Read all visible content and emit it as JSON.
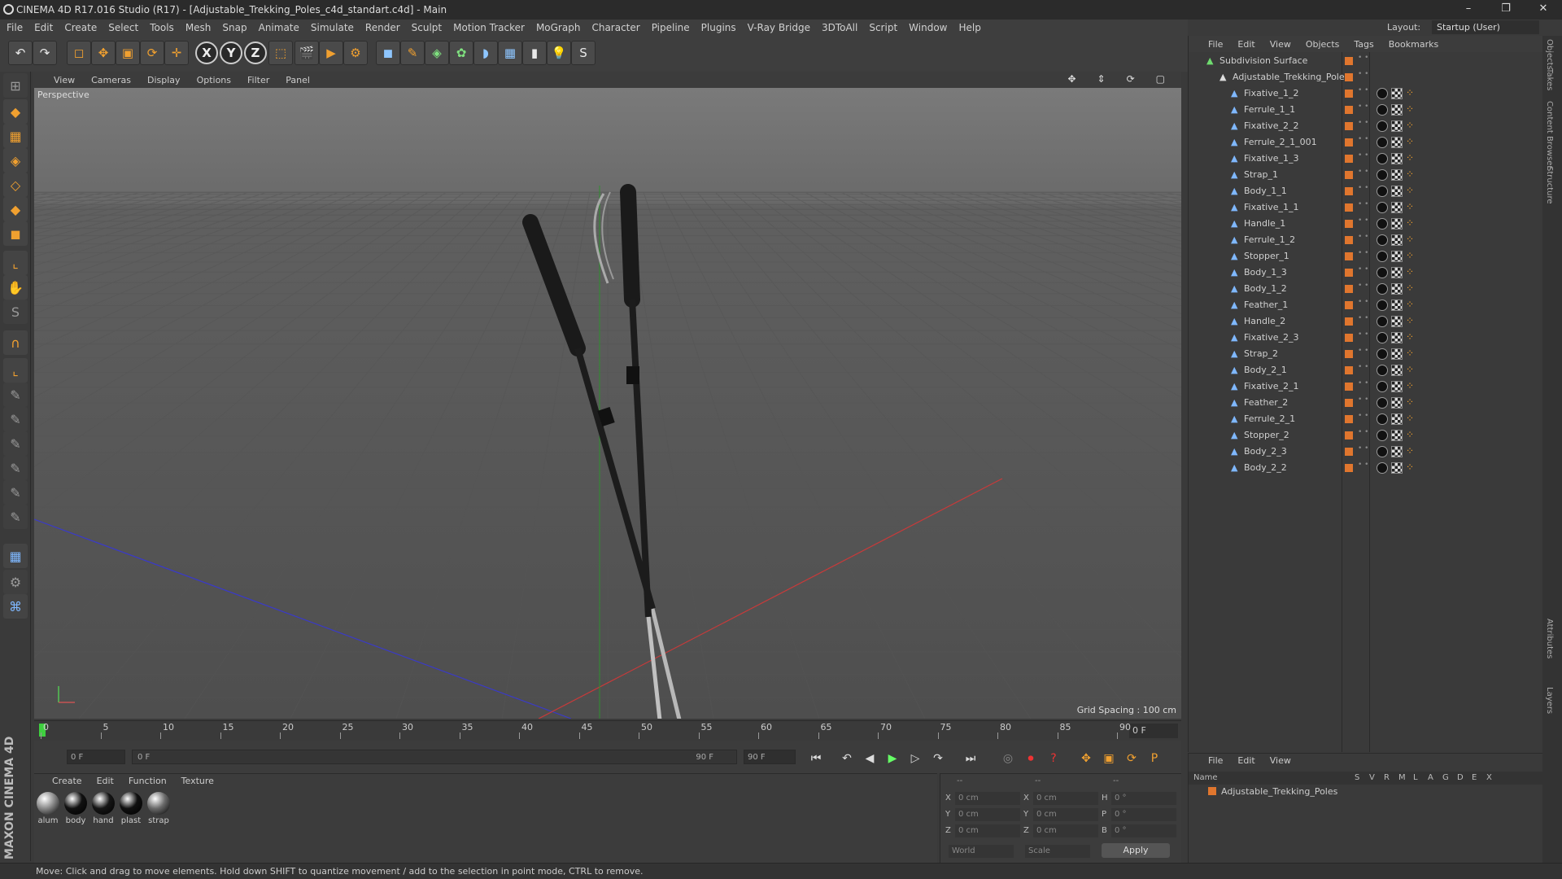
{
  "window": {
    "title": "CINEMA 4D R17.016 Studio (R17) - [Adjustable_Trekking_Poles_c4d_standart.c4d] - Main",
    "controls": [
      "–",
      "❐",
      "✕"
    ]
  },
  "menubar": [
    "File",
    "Edit",
    "Create",
    "Select",
    "Tools",
    "Mesh",
    "Snap",
    "Animate",
    "Simulate",
    "Render",
    "Sculpt",
    "Motion Tracker",
    "MoGraph",
    "Character",
    "Pipeline",
    "Plugins",
    "V-Ray Bridge",
    "3DToAll",
    "Script",
    "Window",
    "Help"
  ],
  "layout": {
    "label": "Layout:",
    "value": "Startup (User)"
  },
  "toolbar_icons": [
    "undo-icon",
    "redo-icon",
    "live-select-icon",
    "move-icon",
    "scale-icon",
    "rotate-icon",
    "move-alt-icon",
    "x-axis-icon",
    "y-axis-icon",
    "z-axis-icon",
    "world-coords-icon",
    "render-view-icon",
    "render-picture-viewer-icon",
    "edit-render-settings-icon",
    "cube-icon",
    "pen-icon",
    "subdivision-icon",
    "cloner-icon",
    "deformer-icon",
    "floor-icon",
    "camera-icon",
    "light-icon",
    "python-icon"
  ],
  "axis_labels": [
    "X",
    "Y",
    "Z"
  ],
  "viewport": {
    "menu": [
      "View",
      "Cameras",
      "Display",
      "Options",
      "Filter",
      "Panel"
    ],
    "label": "Perspective",
    "grid_spacing": "Grid Spacing : 100 cm"
  },
  "timeline": {
    "ticks": [
      "0",
      "5",
      "10",
      "15",
      "20",
      "25",
      "30",
      "35",
      "40",
      "45",
      "50",
      "55",
      "60",
      "65",
      "70",
      "75",
      "80",
      "85",
      "90"
    ],
    "current_frame": "0 F",
    "start_field": "0 F",
    "range_start": "0 F",
    "range_end": "90 F",
    "end_field": "90 F"
  },
  "material_manager": {
    "menu": [
      "Create",
      "Edit",
      "Function",
      "Texture"
    ],
    "materials": [
      {
        "name": "alum",
        "color": "#8a8a8a"
      },
      {
        "name": "body",
        "color": "#111111"
      },
      {
        "name": "hand",
        "color": "#151515"
      },
      {
        "name": "plast",
        "color": "#101010"
      },
      {
        "name": "strap",
        "color": "#6a6a6a"
      }
    ]
  },
  "coords": {
    "header": [
      "--",
      "--",
      "--"
    ],
    "rows": [
      {
        "a": "X",
        "av": "0 cm",
        "b": "X",
        "bv": "0 cm",
        "c": "H",
        "cv": "0 °"
      },
      {
        "a": "Y",
        "av": "0 cm",
        "b": "Y",
        "bv": "0 cm",
        "c": "P",
        "cv": "0 °"
      },
      {
        "a": "Z",
        "av": "0 cm",
        "b": "Z",
        "bv": "0 cm",
        "c": "B",
        "cv": "0 °"
      }
    ],
    "mode1": "World",
    "mode2": "Scale",
    "apply": "Apply"
  },
  "object_manager": {
    "menu": [
      "File",
      "Edit",
      "View",
      "Objects",
      "Tags",
      "Bookmarks"
    ],
    "root": "Subdivision Surface",
    "group": "Adjustable_Trekking_Poles",
    "objects": [
      "Fixative_1_2",
      "Ferrule_1_1",
      "Fixative_2_2",
      "Ferrule_2_1_001",
      "Fixative_1_3",
      "Strap_1",
      "Body_1_1",
      "Fixative_1_1",
      "Handle_1",
      "Ferrule_1_2",
      "Stopper_1",
      "Body_1_3",
      "Body_1_2",
      "Feather_1",
      "Handle_2",
      "Fixative_2_3",
      "Strap_2",
      "Body_2_1",
      "Fixative_2_1",
      "Feather_2",
      "Ferrule_2_1",
      "Stopper_2",
      "Body_2_3",
      "Body_2_2"
    ]
  },
  "layer_manager": {
    "menu": [
      "File",
      "Edit",
      "View"
    ],
    "columns": [
      "Name",
      "S",
      "V",
      "R",
      "M",
      "L",
      "A",
      "G",
      "D",
      "E",
      "X"
    ],
    "row": "Adjustable_Trekking_Poles"
  },
  "right_tabs": [
    "Objects",
    "Takes",
    "Content Browser",
    "Structure",
    "Attributes",
    "Layers"
  ],
  "status": "Move: Click and drag to move elements. Hold down SHIFT to quantize movement / add to the selection in point mode, CTRL to remove.",
  "brand": "MAXON CINEMA 4D"
}
